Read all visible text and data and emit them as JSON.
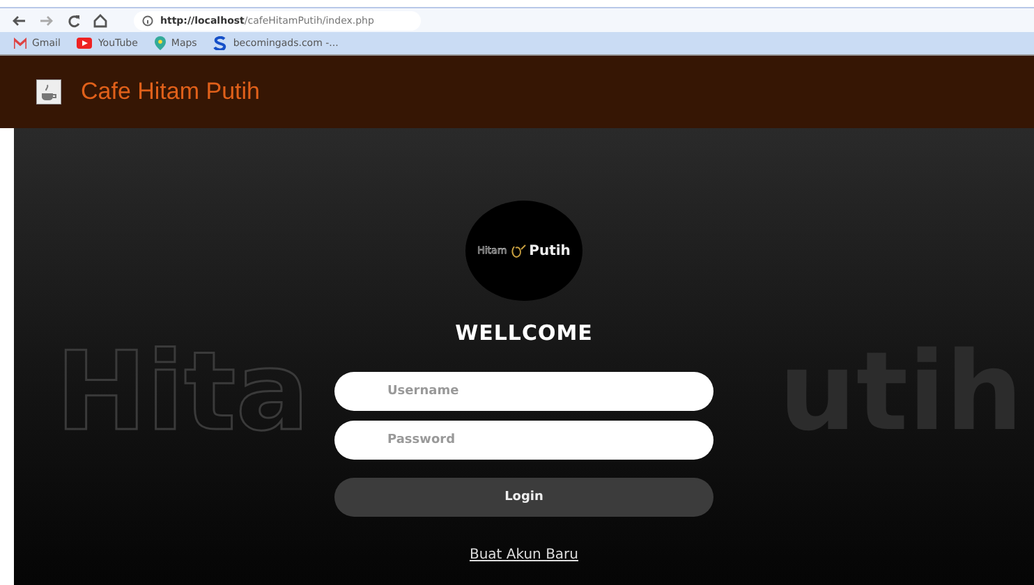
{
  "browser": {
    "url_host": "http://localhost",
    "url_path": "/cafeHitamPutih/index.php",
    "bookmarks": [
      {
        "label": "Gmail",
        "kind": "gmail"
      },
      {
        "label": "YouTube",
        "kind": "youtube"
      },
      {
        "label": "Maps",
        "kind": "maps"
      },
      {
        "label": "becomingads.com -...",
        "kind": "site"
      }
    ]
  },
  "header": {
    "title": "Cafe Hitam Putih"
  },
  "logo": {
    "word_1": "Hitam",
    "word_2": "Putih"
  },
  "background_words": [
    "Hita",
    "utih"
  ],
  "form": {
    "heading": "WELLCOME",
    "fields": [
      {
        "placeholder": "Username"
      },
      {
        "placeholder": "Password"
      }
    ],
    "button": "Login",
    "link": "Buat Akun Baru"
  }
}
